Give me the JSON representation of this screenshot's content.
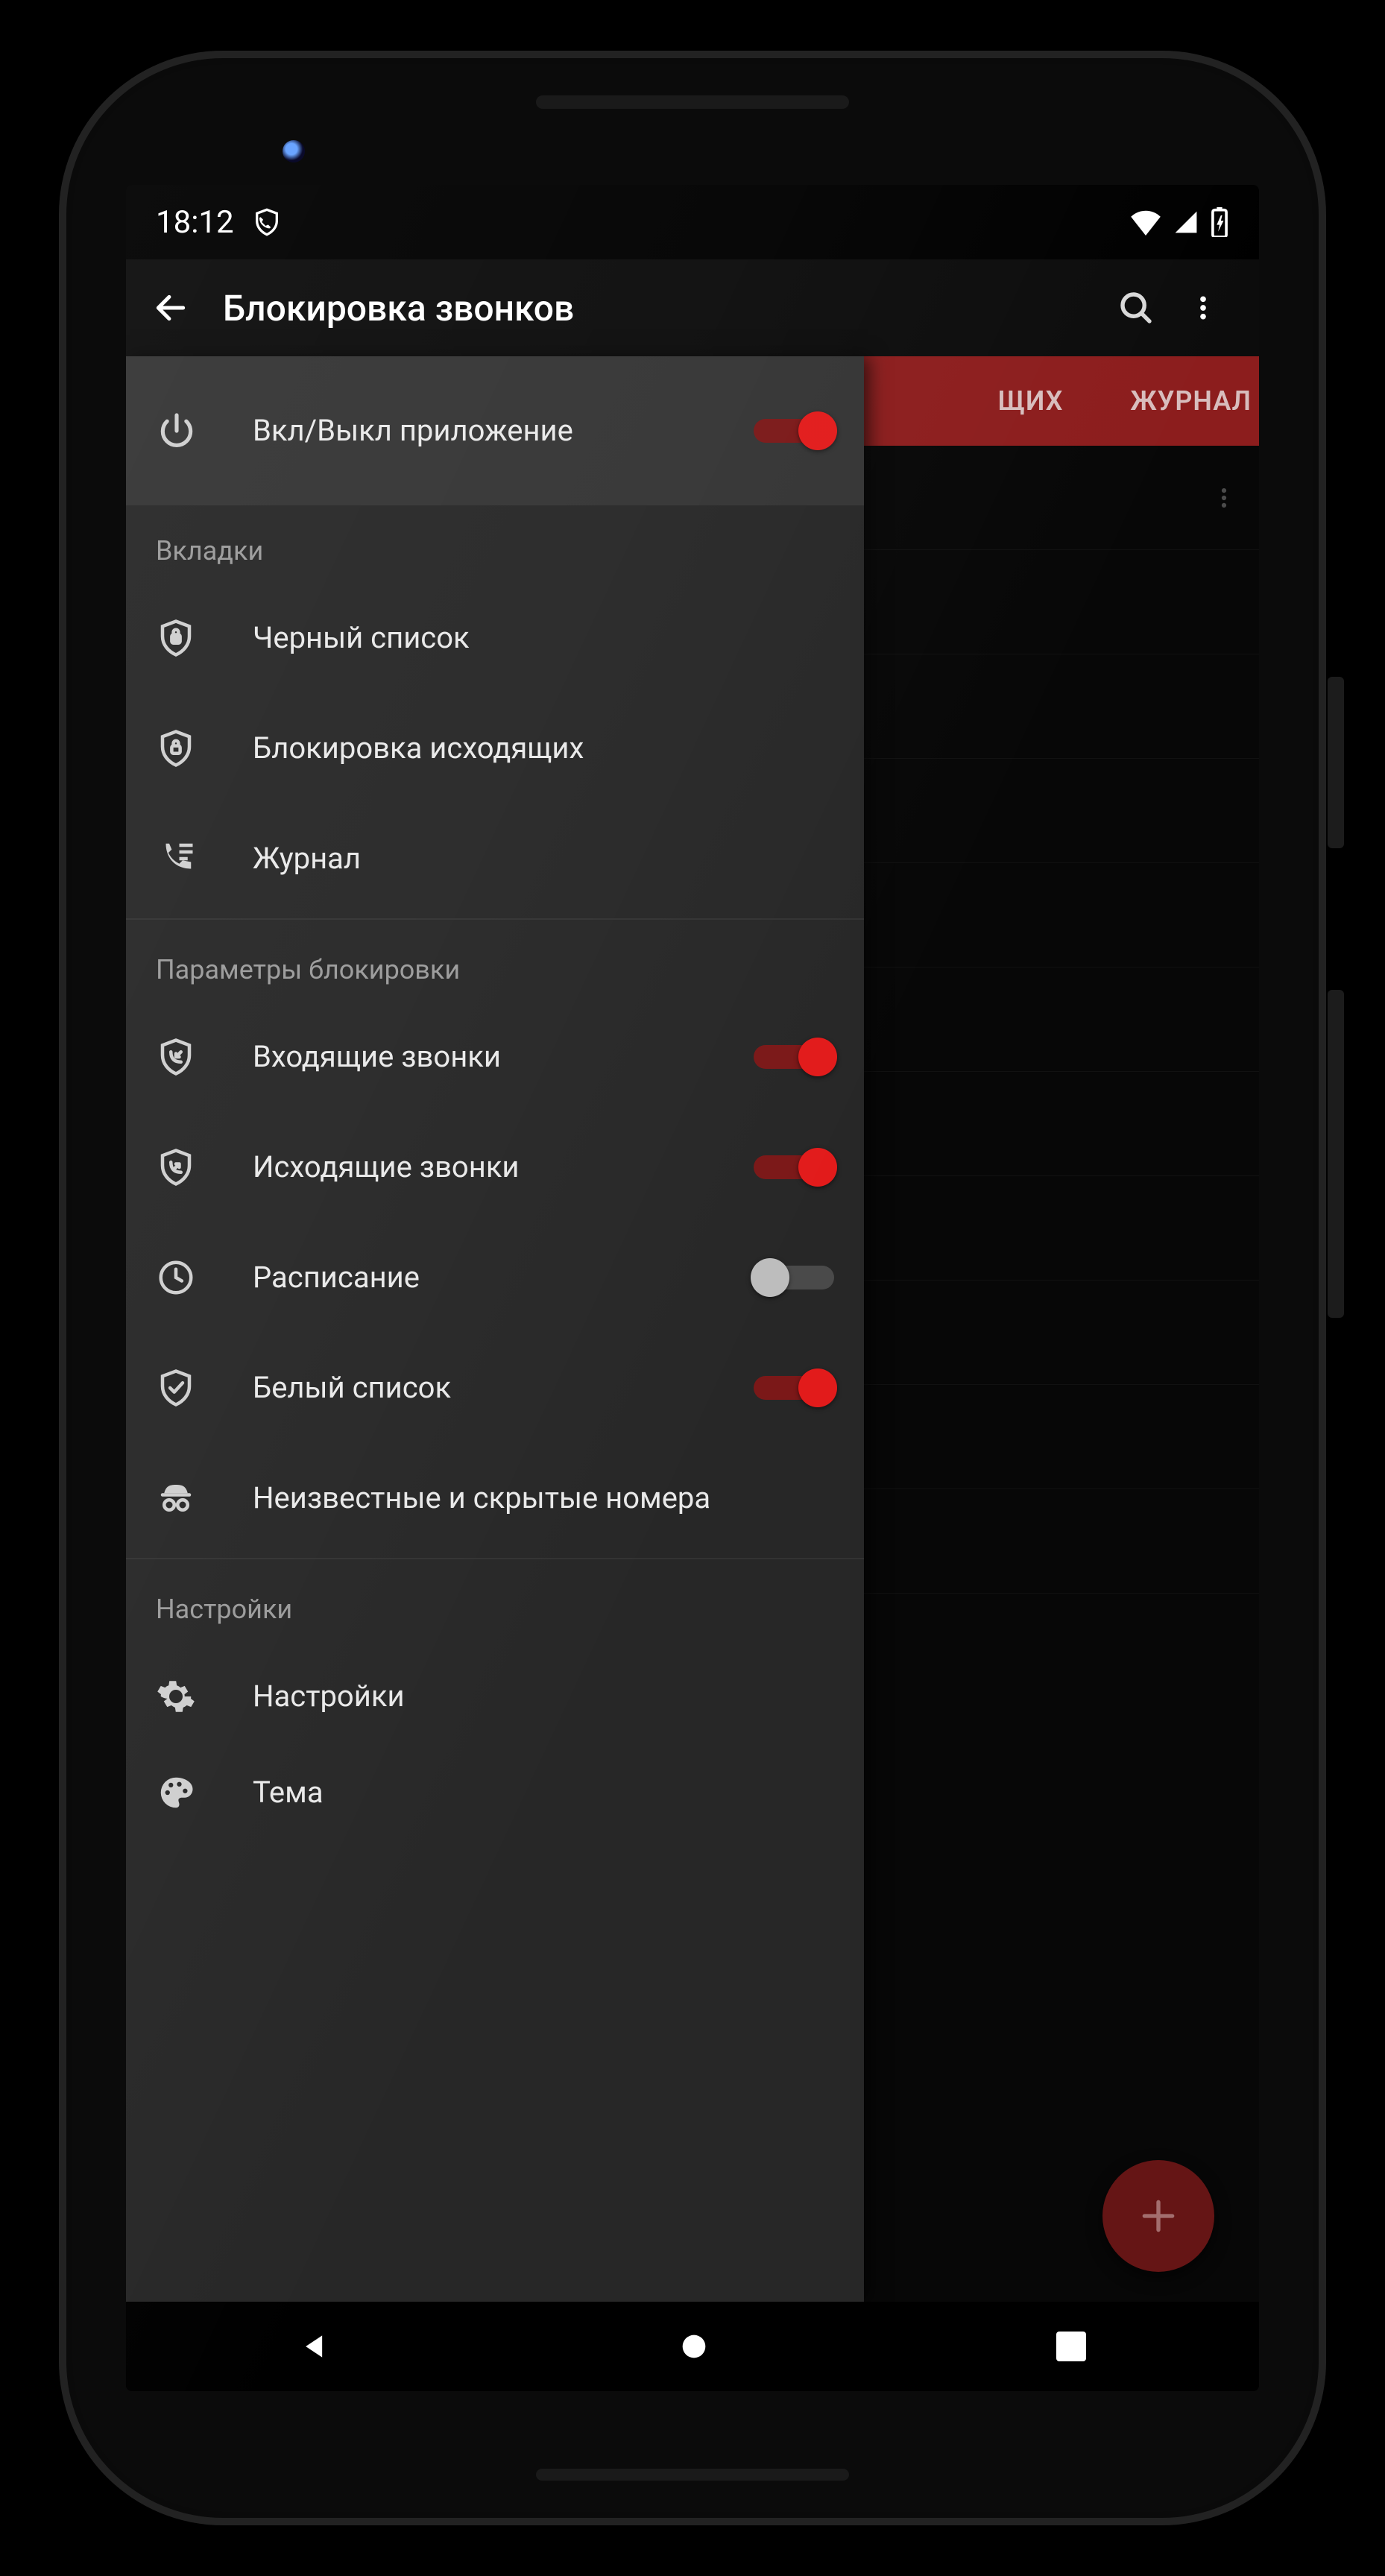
{
  "status": {
    "time": "18:12"
  },
  "toolbar": {
    "title": "Блокировка звонков"
  },
  "tabs": {
    "t2_suffix": "ЩИХ",
    "t3": "ЖУРНАЛ"
  },
  "drawer": {
    "hero_label": "Вкл/Выкл приложение",
    "hero_on": true,
    "sections": {
      "tabs": {
        "title": "Вкладки",
        "items": [
          {
            "label": "Черный список"
          },
          {
            "label": "Блокировка исходящих"
          },
          {
            "label": "Журнал"
          }
        ]
      },
      "block": {
        "title": "Параметры блокировки",
        "items": [
          {
            "label": "Входящие звонки",
            "on": true
          },
          {
            "label": "Исходящие звонки",
            "on": true
          },
          {
            "label": "Расписание",
            "on": false
          },
          {
            "label": "Белый список",
            "on": true
          },
          {
            "label": "Неизвестные и скрытые номера"
          }
        ]
      },
      "settings": {
        "title": "Настройки",
        "items": [
          {
            "label": "Настройки"
          },
          {
            "label": "Тема"
          }
        ]
      }
    }
  }
}
